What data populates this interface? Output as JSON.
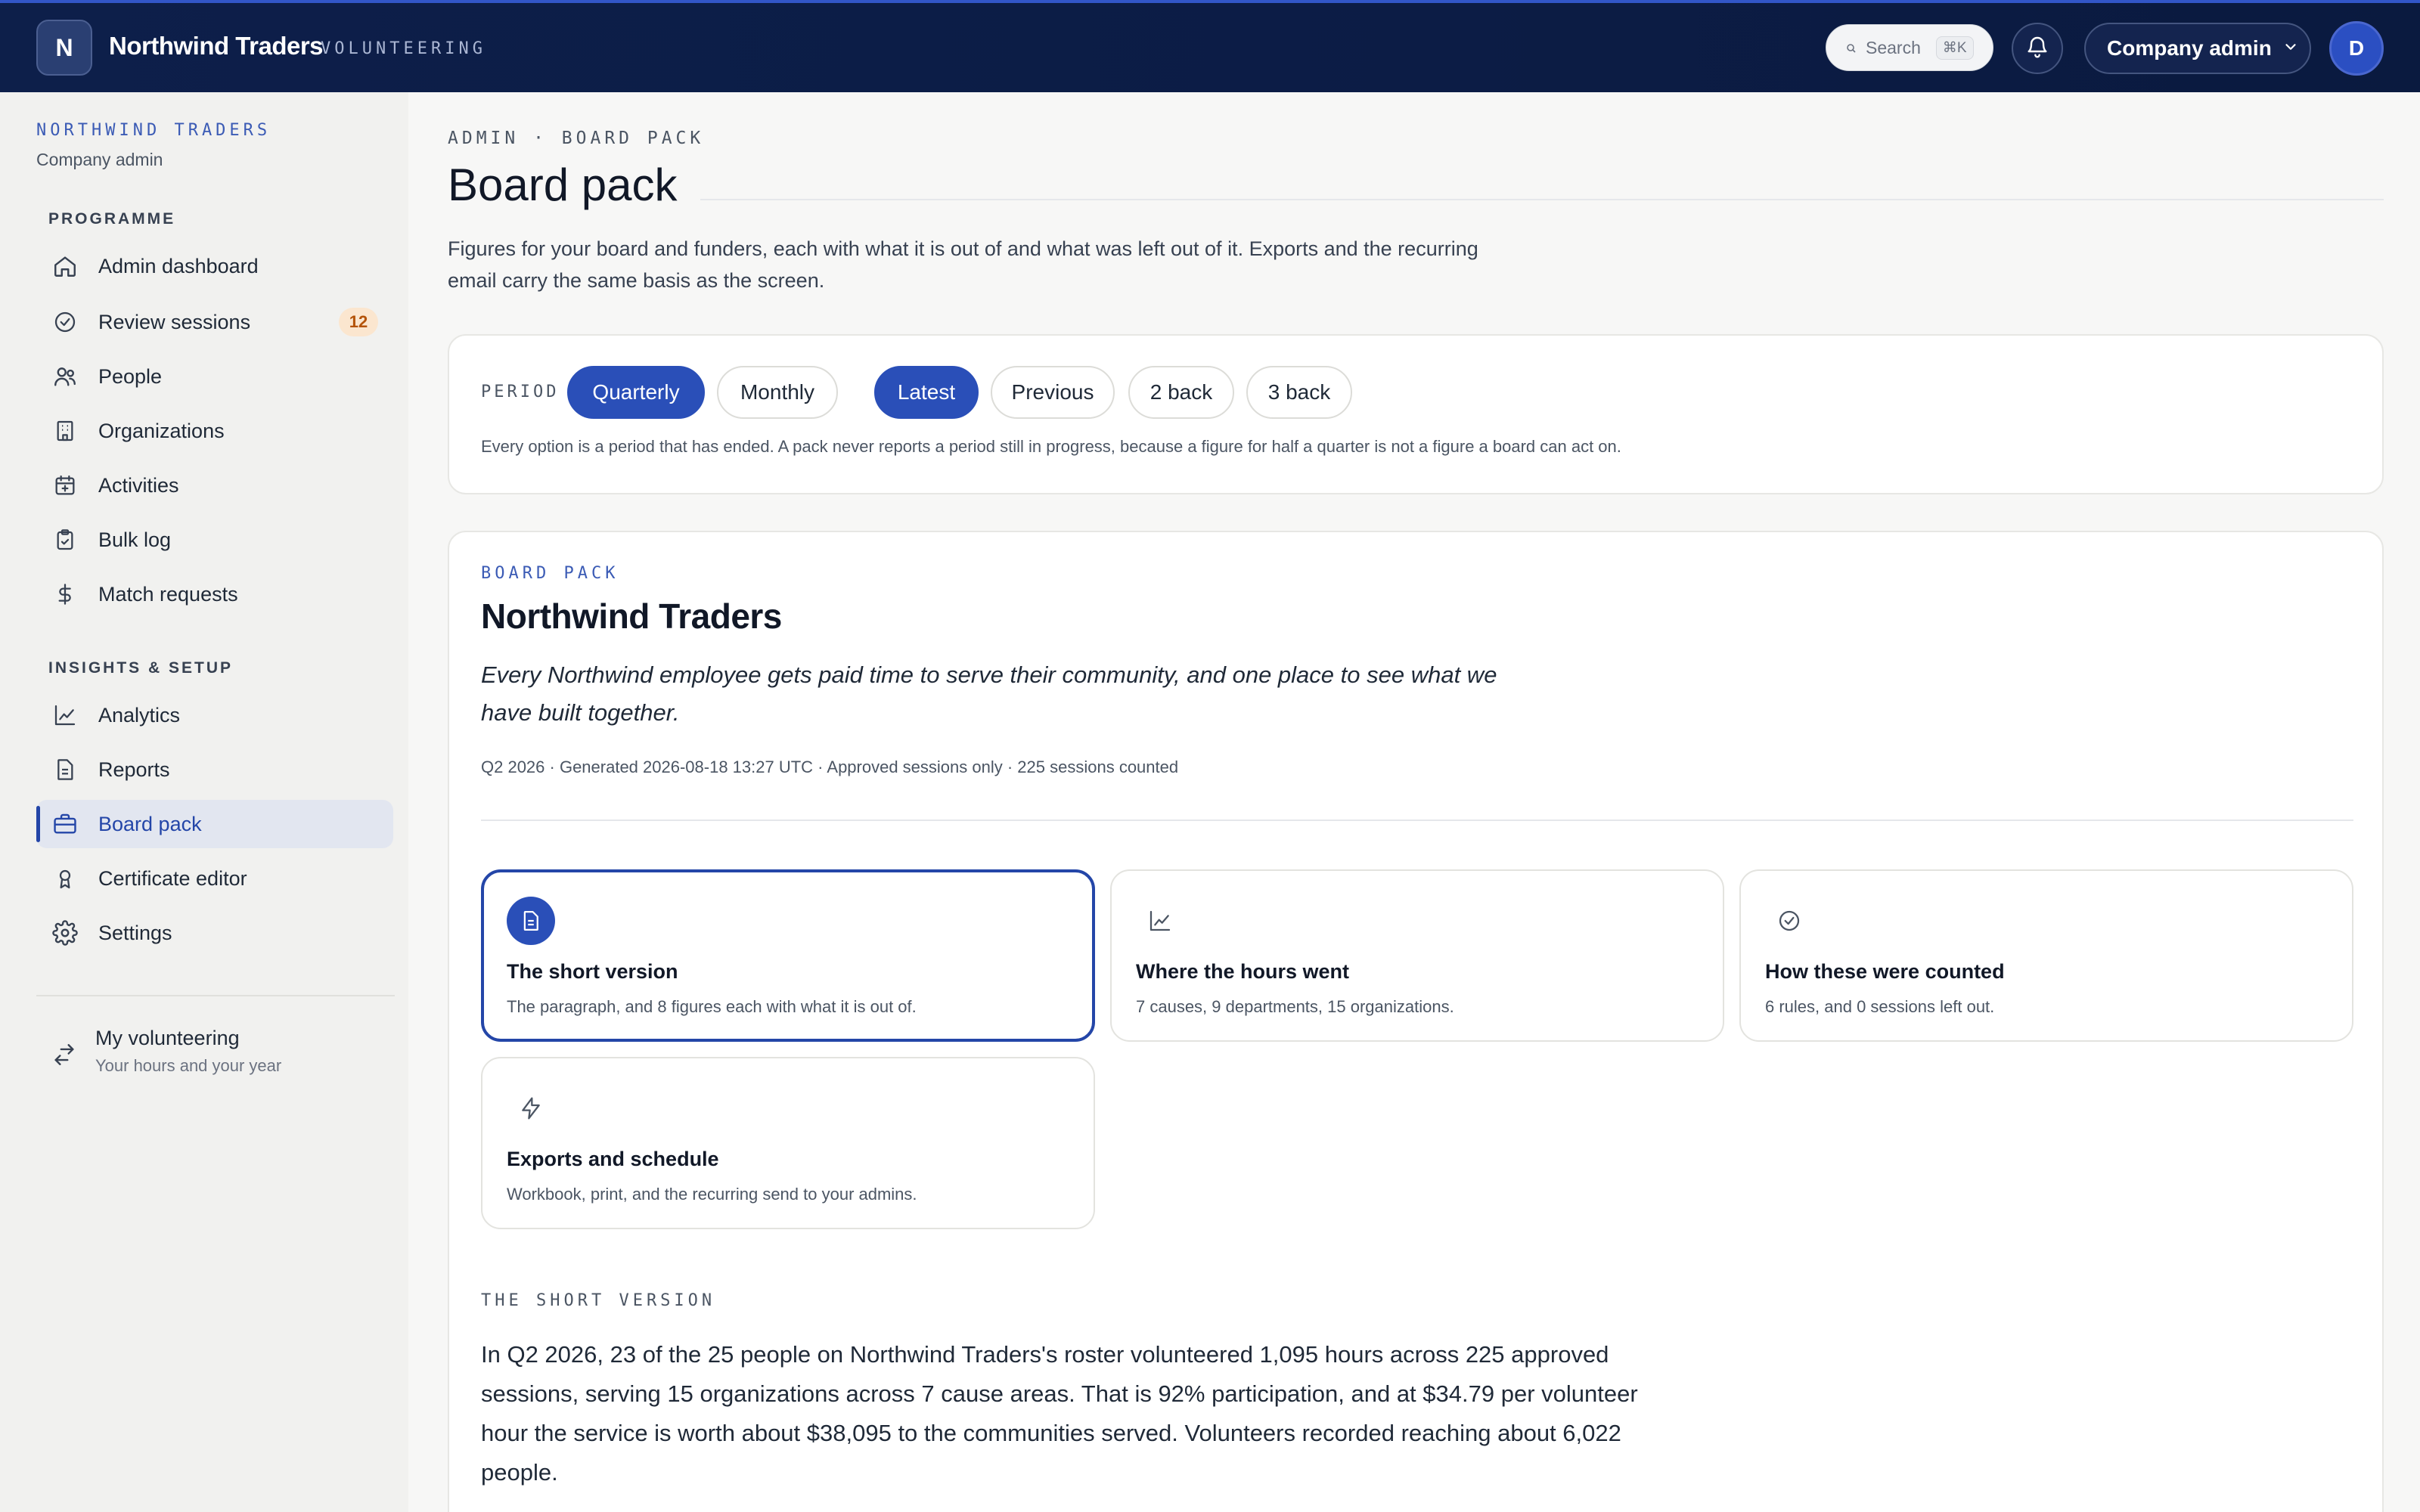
{
  "header": {
    "brand_initial": "N",
    "brand_name": "Northwind Traders",
    "brand_sub": "VOLUNTEERING",
    "search_placeholder": "Search",
    "search_shortcut": "⌘K",
    "role_label": "Company admin",
    "avatar_initial": "D"
  },
  "sidebar": {
    "org_name": "NORTHWIND TRADERS",
    "org_role": "Company admin",
    "section_programme": "PROGRAMME",
    "section_insights": "INSIGHTS & SETUP",
    "items": [
      {
        "label": "Admin dashboard",
        "icon": "home-icon"
      },
      {
        "label": "Review sessions",
        "icon": "check-circle-icon",
        "badge": "12"
      },
      {
        "label": "People",
        "icon": "people-icon"
      },
      {
        "label": "Organizations",
        "icon": "building-icon"
      },
      {
        "label": "Activities",
        "icon": "calendar-plus-icon"
      },
      {
        "label": "Bulk log",
        "icon": "clipboard-icon"
      },
      {
        "label": "Match requests",
        "icon": "dollar-icon"
      },
      {
        "label": "Analytics",
        "icon": "chart-line-icon"
      },
      {
        "label": "Reports",
        "icon": "document-icon"
      },
      {
        "label": "Board pack",
        "icon": "briefcase-icon",
        "active": true
      },
      {
        "label": "Certificate editor",
        "icon": "award-icon"
      },
      {
        "label": "Settings",
        "icon": "gear-icon"
      }
    ],
    "my_volunteering": {
      "title": "My volunteering",
      "subtitle": "Your hours and your year",
      "icon": "swap-arrows-icon"
    }
  },
  "page": {
    "breadcrumb": "ADMIN · BOARD PACK",
    "title": "Board pack",
    "description": "Figures for your board and funders, each with what it is out of and what was left out of it. Exports and the recurring email carry the same basis as the screen."
  },
  "period": {
    "label": "PERIOD",
    "granularity": [
      {
        "label": "Quarterly",
        "selected": true
      },
      {
        "label": "Monthly",
        "selected": false
      }
    ],
    "offsets": [
      {
        "label": "Latest",
        "selected": true
      },
      {
        "label": "Previous",
        "selected": false
      },
      {
        "label": "2 back",
        "selected": false
      },
      {
        "label": "3 back",
        "selected": false
      }
    ],
    "note": "Every option is a period that has ended. A pack never reports a period still in progress, because a figure for half a quarter is not a figure a board can act on."
  },
  "pack": {
    "eyebrow": "BOARD PACK",
    "org_title": "Northwind Traders",
    "mission": "Every Northwind employee gets paid time to serve their community, and one place to see what we have built together.",
    "meta": "Q2 2026 · Generated 2026-08-18 13:27 UTC · Approved sessions only · 225 sessions counted",
    "tiles": [
      {
        "title": "The short version",
        "desc": "The paragraph, and 8 figures each with what it is out of.",
        "icon": "document-icon",
        "selected": true
      },
      {
        "title": "Where the hours went",
        "desc": "7 causes, 9 departments, 15 organizations.",
        "icon": "chart-line-icon",
        "selected": false
      },
      {
        "title": "How these were counted",
        "desc": "6 rules, and 0 sessions left out.",
        "icon": "check-circle-icon",
        "selected": false
      },
      {
        "title": "Exports and schedule",
        "desc": "Workbook, print, and the recurring send to your admins.",
        "icon": "lightning-icon",
        "selected": false
      }
    ],
    "short_version_eyebrow": "THE SHORT VERSION",
    "short_version_text": "In Q2 2026, 23 of the 25 people on Northwind Traders's roster volunteered 1,095 hours across 225 approved sessions, serving 15 organizations across 7 cause areas. That is 92% participation, and at $34.79 per volunteer hour the service is worth about $38,095 to the communities served. Volunteers recorded reaching about 6,022 people."
  },
  "colors": {
    "topbar": "#0d1f4a",
    "accent": "#2a4fb8",
    "badge_bg": "#fbe6cf",
    "badge_text": "#b45309"
  }
}
